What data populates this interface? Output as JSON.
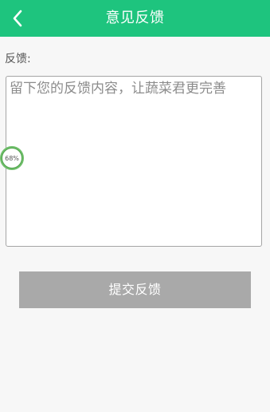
{
  "header": {
    "title": "意见反馈",
    "back_icon": "chevron-left-icon",
    "background_color": "#1ec47e"
  },
  "form": {
    "feedback_label": "反馈:",
    "feedback_input": {
      "value": "",
      "placeholder": "留下您的反馈内容，让蔬菜君更完善"
    },
    "submit_label": "提交反馈",
    "submit_color": "#a9a9a9"
  },
  "overlay": {
    "progress_text": "68%",
    "progress_value": 68
  }
}
